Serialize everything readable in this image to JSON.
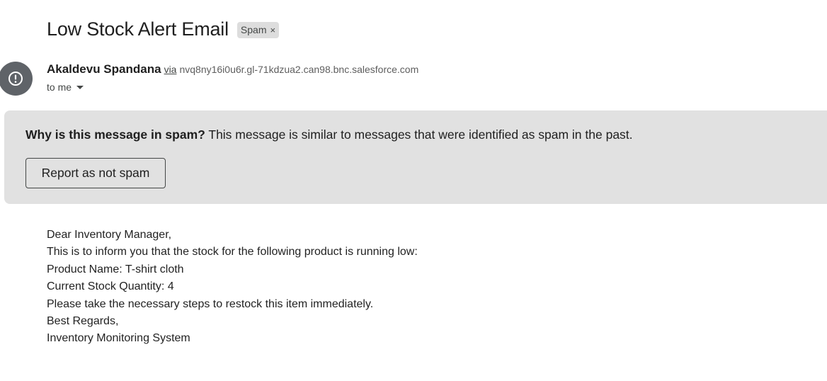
{
  "email": {
    "subject": "Low Stock Alert Email",
    "label_chip": {
      "text": "Spam",
      "close_symbol": "×"
    },
    "sender": {
      "name": "Akaldevu Spandana",
      "via_label": "via",
      "via_domain": "nvq8ny16i0u6r.gl-71kdzua2.can98.bnc.salesforce.com",
      "avatar_icon": "alert-circle-icon",
      "avatar_color": "#5f6368"
    },
    "recipient": {
      "text": "to me"
    }
  },
  "spam_banner": {
    "question": "Why is this message in spam?",
    "explanation": "This message is similar to messages that were identified as spam in the past.",
    "report_button": "Report as not spam",
    "background_color": "#e1e1e1"
  },
  "body_lines": [
    "Dear Inventory Manager,",
    "This is to inform you that the stock for the following product is running low:",
    "Product Name: T-shirt cloth",
    "Current Stock Quantity: 4",
    "Please take the necessary steps to restock this item immediately.",
    "Best Regards,",
    "Inventory Monitoring System"
  ]
}
